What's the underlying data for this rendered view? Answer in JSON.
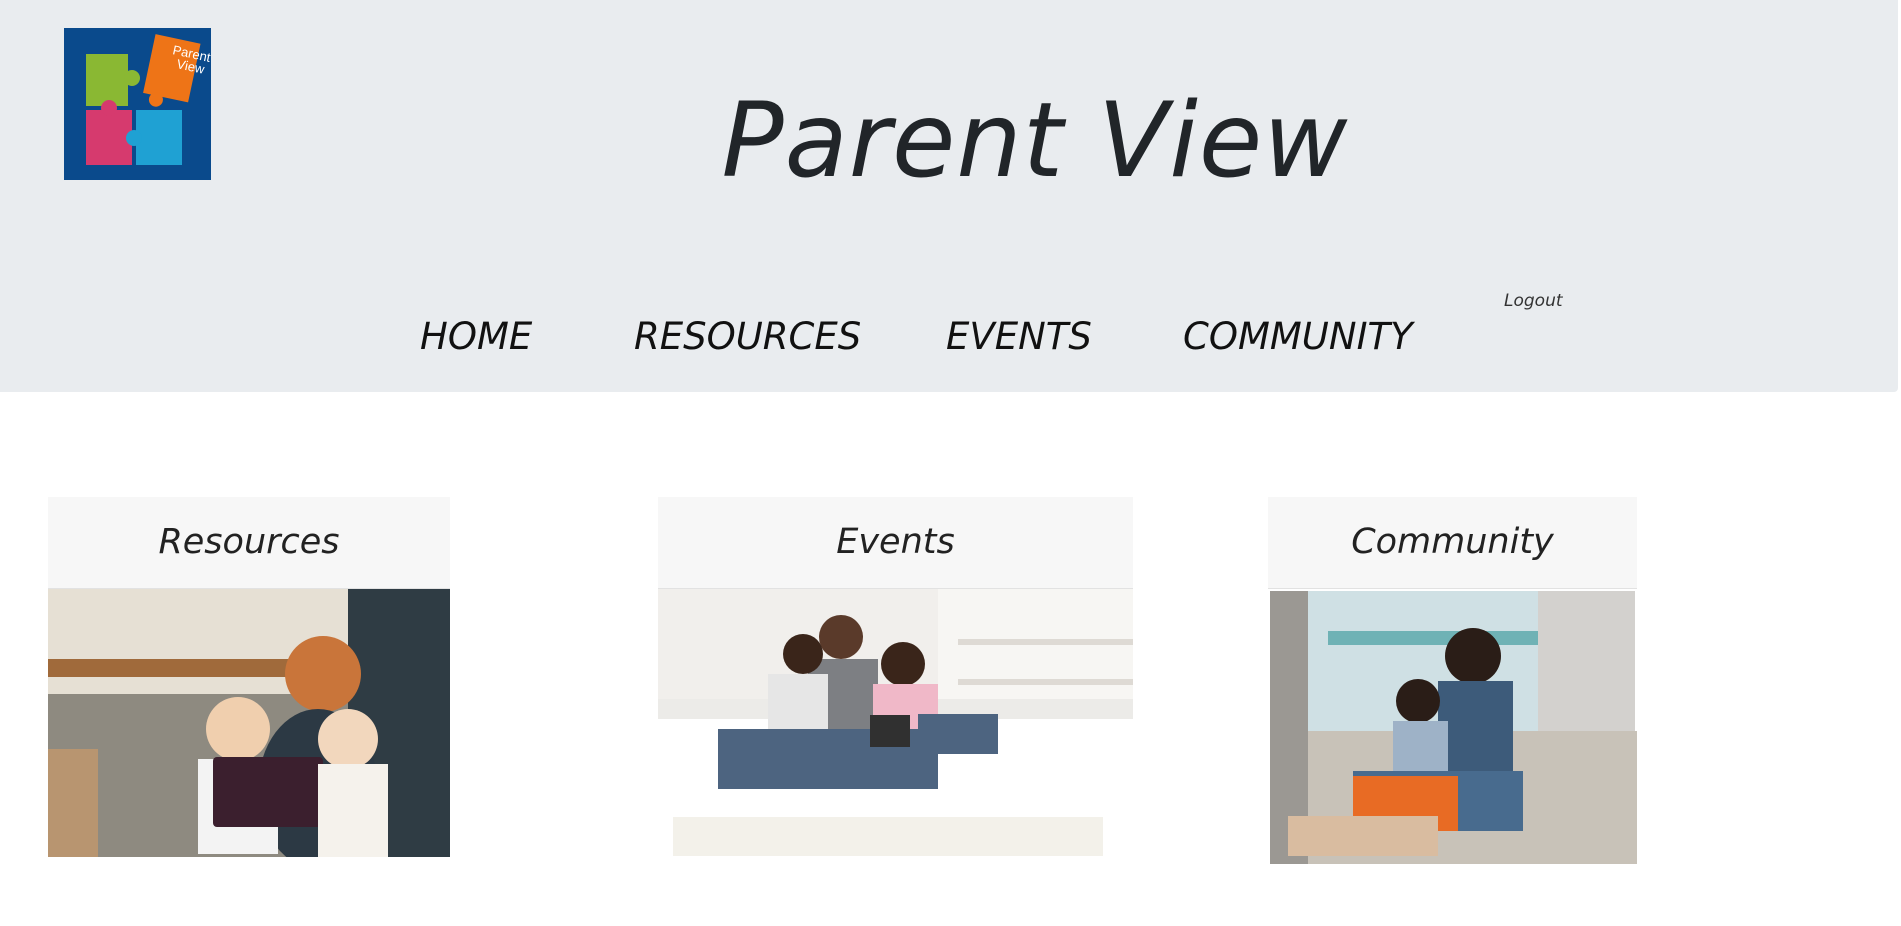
{
  "header": {
    "title": "Parent View",
    "logo_text": [
      "Parent",
      "View"
    ],
    "logout": "Logout"
  },
  "nav": {
    "items": [
      {
        "label": "HOME"
      },
      {
        "label": "RESOURCES"
      },
      {
        "label": "EVENTS"
      },
      {
        "label": "COMMUNITY"
      }
    ]
  },
  "cards": [
    {
      "title": "Resources"
    },
    {
      "title": "Events"
    },
    {
      "title": "Community"
    }
  ],
  "colors": {
    "header_bg": "#e9ecef",
    "logo_bg": "#0a4a8c",
    "puzzle_green": "#8ab833",
    "puzzle_orange": "#ee7417",
    "puzzle_pink": "#d63a6e",
    "puzzle_blue": "#1fa1d3"
  }
}
